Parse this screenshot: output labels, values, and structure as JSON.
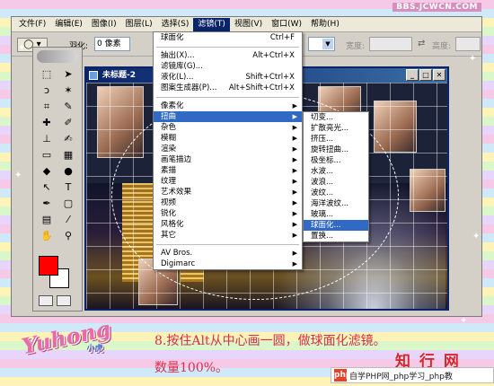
{
  "site_url": "BBS.JCWCN.COM",
  "menubar": [
    "文件(F)",
    "编辑(E)",
    "图像(I)",
    "图层(L)",
    "选择(S)",
    "滤镜(T)",
    "视图(V)",
    "窗口(W)",
    "帮助(H)"
  ],
  "active_menu_index": 5,
  "options": {
    "marquee_icon": "elliptical-marquee-icon",
    "feather_label": "羽化:",
    "feather_value": "0 像素",
    "width_label": "宽度:",
    "height_label": "高度:"
  },
  "document": {
    "title": "未标题-2"
  },
  "filter_menu": {
    "items": [
      {
        "label": "球面化",
        "shortcut": "Ctrl+F"
      },
      {
        "sep": true
      },
      {
        "label": "抽出(X)...",
        "shortcut": "Alt+Ctrl+X"
      },
      {
        "label": "滤镜库(G)..."
      },
      {
        "label": "液化(L)...",
        "shortcut": "Shift+Ctrl+X"
      },
      {
        "label": "图案生成器(P)...",
        "shortcut": "Alt+Shift+Ctrl+X"
      },
      {
        "sep": true
      },
      {
        "label": "像素化",
        "submenu": true
      },
      {
        "label": "扭曲",
        "submenu": true,
        "highlighted": true
      },
      {
        "label": "杂色",
        "submenu": true
      },
      {
        "label": "模糊",
        "submenu": true
      },
      {
        "label": "渲染",
        "submenu": true
      },
      {
        "label": "画笔描边",
        "submenu": true
      },
      {
        "label": "素描",
        "submenu": true
      },
      {
        "label": "纹理",
        "submenu": true
      },
      {
        "label": "艺术效果",
        "submenu": true
      },
      {
        "label": "视频",
        "submenu": true
      },
      {
        "label": "锐化",
        "submenu": true
      },
      {
        "label": "风格化",
        "submenu": true
      },
      {
        "label": "其它",
        "submenu": true
      },
      {
        "sep": true
      },
      {
        "label": "AV Bros.",
        "submenu": true
      },
      {
        "label": "Digimarc",
        "submenu": true
      }
    ]
  },
  "distort_menu": {
    "items": [
      {
        "label": "切变..."
      },
      {
        "label": "扩散亮光..."
      },
      {
        "label": "挤压..."
      },
      {
        "label": "旋转扭曲..."
      },
      {
        "label": "极坐标..."
      },
      {
        "label": "水波..."
      },
      {
        "label": "波浪..."
      },
      {
        "label": "波纹..."
      },
      {
        "label": "海洋波纹..."
      },
      {
        "label": "玻璃..."
      },
      {
        "label": "球面化...",
        "highlighted": true
      },
      {
        "label": "置换..."
      }
    ]
  },
  "colors": {
    "foreground": "#ff0000",
    "background": "#ffffff",
    "menu_highlight": "#316ac5",
    "caption": "#d72f4d"
  },
  "caption": {
    "line1": "8.按住Alt从中心画一圆，做球面化滤镜。",
    "line2": "数量100%。"
  },
  "logo": {
    "text": "Yuhong",
    "sub": "小虎"
  },
  "brand": "知 行 网",
  "footer_site": {
    "badge": "php",
    "text": "自学PHP网_php学习_php教"
  }
}
